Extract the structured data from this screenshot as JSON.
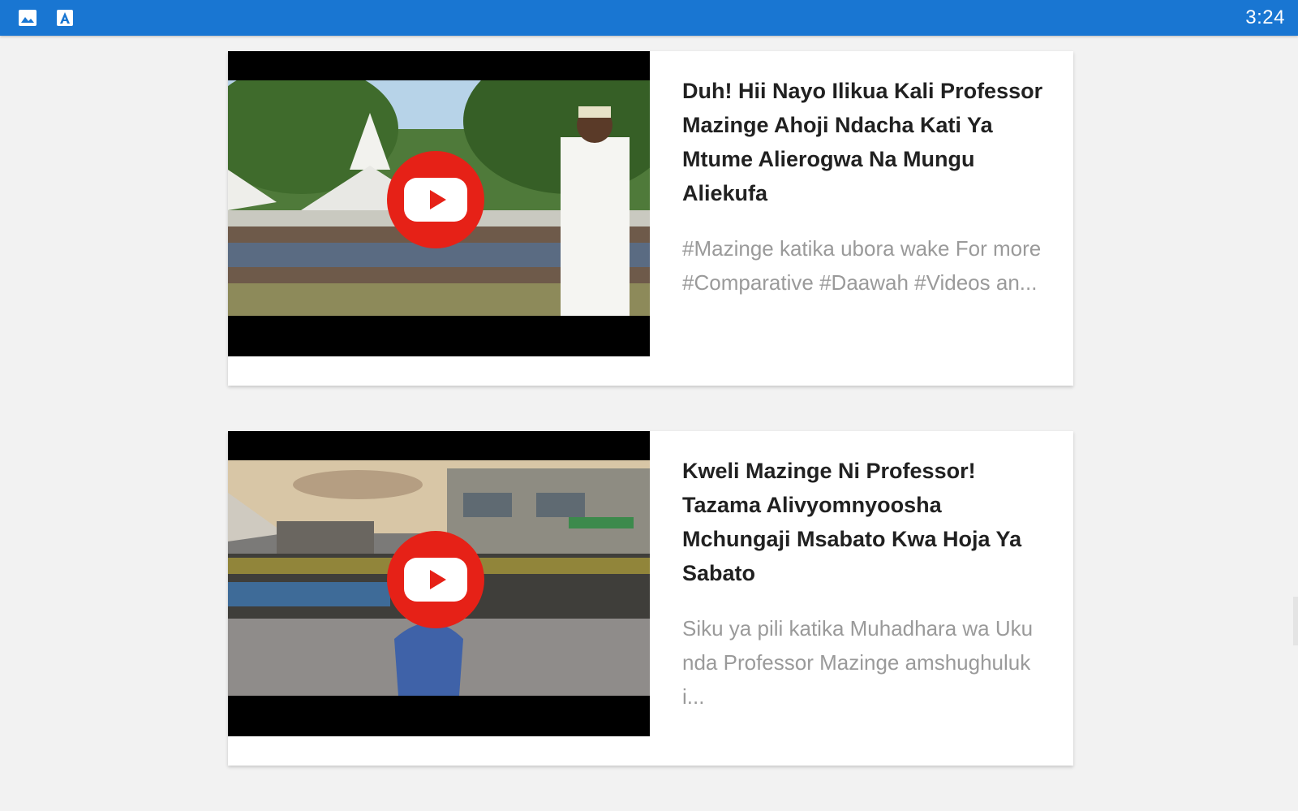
{
  "status_bar": {
    "time": "3:24",
    "icons": [
      "image-icon",
      "app-store-icon"
    ],
    "color": "#1976d2"
  },
  "videos": [
    {
      "title": "Duh! Hii Nayo Ilikua Kali Professor Mazinge Ahoji Ndacha Kati Ya Mtume Alierogwa Na Mungu Aliekufa",
      "description": "#Mazinge katika ubora wake For more #Comparative #Daawah #Videos an..."
    },
    {
      "title": "Kweli Mazinge Ni Professor! Tazama Alivyomnyoosha Mchungaji Msabato Kwa Hoja Ya Sabato",
      "description": "Siku ya pili katika Muhadhara wa Ukunda Professor Mazinge amshughuluki..."
    }
  ],
  "colors": {
    "play_button": "#e62117",
    "title_text": "#212121",
    "description_text": "#9a9a9a"
  }
}
